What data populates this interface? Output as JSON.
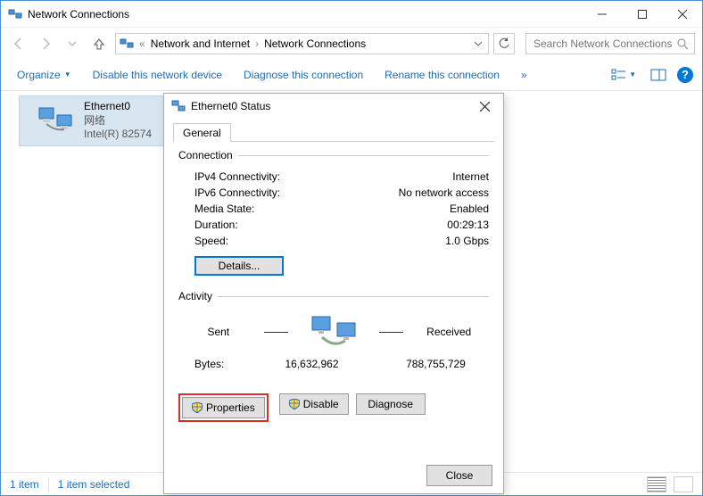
{
  "titlebar": {
    "title": "Network Connections"
  },
  "breadcrumb": {
    "item1": "Network and Internet",
    "item2": "Network Connections"
  },
  "search": {
    "placeholder": "Search Network Connections"
  },
  "cmdbar": {
    "organize": "Organize",
    "disable": "Disable this network device",
    "diagnose": "Diagnose this connection",
    "rename": "Rename this connection",
    "more": "»"
  },
  "connection": {
    "name": "Ethernet0",
    "line2": "网络",
    "line3": "Intel(R) 82574"
  },
  "statusbar": {
    "count": "1 item",
    "selected": "1 item selected"
  },
  "dialog": {
    "title": "Ethernet0 Status",
    "tab": "General",
    "group_connection": "Connection",
    "ipv4_lbl": "IPv4 Connectivity:",
    "ipv4_val": "Internet",
    "ipv6_lbl": "IPv6 Connectivity:",
    "ipv6_val": "No network access",
    "media_lbl": "Media State:",
    "media_val": "Enabled",
    "duration_lbl": "Duration:",
    "duration_val": "00:29:13",
    "speed_lbl": "Speed:",
    "speed_val": "1.0 Gbps",
    "details_btn": "Details...",
    "group_activity": "Activity",
    "sent": "Sent",
    "received": "Received",
    "bytes_lbl": "Bytes:",
    "bytes_sent": "16,632,962",
    "bytes_recv": "788,755,729",
    "properties_btn": "Properties",
    "disable_btn": "Disable",
    "diagnose_btn": "Diagnose",
    "close_btn": "Close"
  }
}
